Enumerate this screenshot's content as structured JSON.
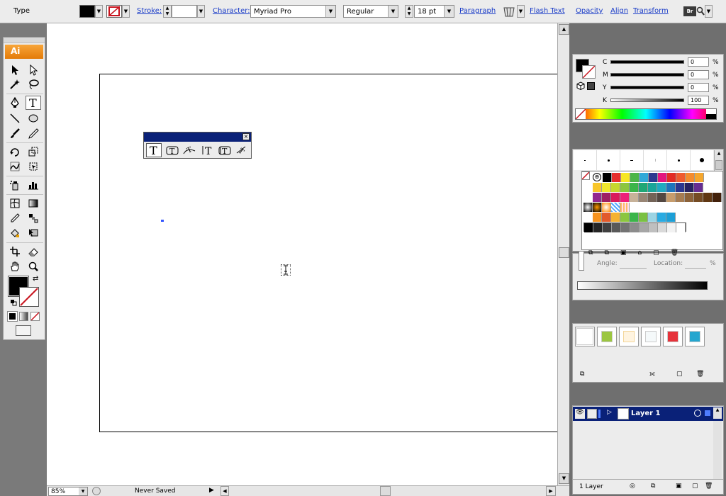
{
  "control_bar": {
    "mode_label": "Type",
    "stroke_label": "Stroke:",
    "character_label": "Character:",
    "font_family": "Myriad Pro",
    "font_style": "Regular",
    "font_size": "18 pt",
    "paragraph_label": "Paragraph",
    "flash_text_label": "Flash Text",
    "opacity_label": "Opacity",
    "align_label": "Align",
    "transform_label": "Transform"
  },
  "toolbox": {
    "logo": "Ai"
  },
  "color_panel": {
    "channels": [
      {
        "label": "C",
        "value": "0",
        "unit": "%"
      },
      {
        "label": "M",
        "value": "0",
        "unit": "%"
      },
      {
        "label": "Y",
        "value": "0",
        "unit": "%"
      },
      {
        "label": "K",
        "value": "100",
        "unit": "%"
      }
    ]
  },
  "gradient_panel": {
    "angle_label": "Angle:",
    "location_label": "Location:",
    "location_unit": "%"
  },
  "layers_panel": {
    "layer_name": "Layer 1",
    "layer_count": "1 Layer"
  },
  "status_bar": {
    "zoom": "85%",
    "save_state": "Never Saved"
  },
  "colors": {
    "swatches_row1": [
      "#ffffff",
      "#000000",
      "#e62e2d",
      "#f7e622",
      "#4cb648",
      "#31a9d8",
      "#2c3990",
      "#e3157e",
      "#e32c25",
      "#ef5b2f",
      "#f48c2e",
      "#f5a62d"
    ],
    "swatches_row2": [
      "#f8c62a",
      "#f0e82d",
      "#c6d82f",
      "#8cc63f",
      "#3bb54a",
      "#1fa776",
      "#1aa599",
      "#20aac1",
      "#1d75bc",
      "#2b3790",
      "#262262",
      "#662d91"
    ],
    "swatches_row3": [
      "#92278f",
      "#9e1f63",
      "#d91c5c",
      "#ed1e79",
      "#c7b299",
      "#998675",
      "#736357",
      "#534741",
      "#c69c6d",
      "#a67c52",
      "#8c6239",
      "#754c24"
    ],
    "swatches_row4": [
      "#603813",
      "#42210b"
    ],
    "swatches_row5": [
      "#f7931e",
      "#e25a2b",
      "#f4b233",
      "#8cc63f",
      "#3bb54a",
      "#7ac143",
      "#9bd4e4",
      "#29abe2",
      "#1d9fd6"
    ],
    "grays": [
      "#000000",
      "#262626",
      "#404040",
      "#595959",
      "#737373",
      "#8c8c8c",
      "#a6a6a6",
      "#bfbfbf",
      "#d9d9d9",
      "#f2f2f2",
      "#ffffff"
    ],
    "graphic_styles": [
      "#ffffff",
      "#9cc642",
      "#fff4e0",
      "#f5f9fa",
      "#e6333b",
      "#24a6cf"
    ]
  }
}
